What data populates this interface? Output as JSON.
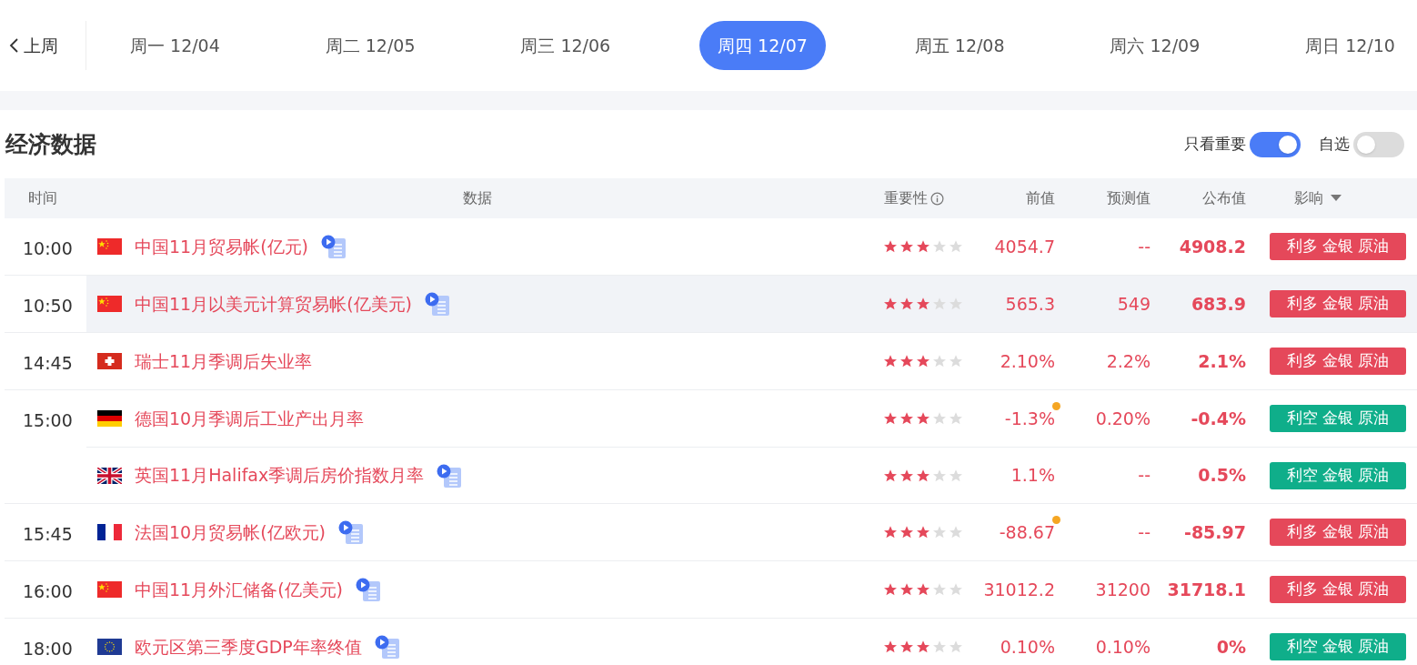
{
  "week_nav": {
    "prev_label": "上周",
    "days": [
      {
        "label": "周一 12/04",
        "selected": false
      },
      {
        "label": "周二 12/05",
        "selected": false
      },
      {
        "label": "周三 12/06",
        "selected": false
      },
      {
        "label": "周四 12/07",
        "selected": true
      },
      {
        "label": "周五 12/08",
        "selected": false
      },
      {
        "label": "周六 12/09",
        "selected": false
      },
      {
        "label": "周日 12/10",
        "selected": false
      }
    ]
  },
  "section": {
    "title": "经济数据",
    "toggles": [
      {
        "label": "只看重要",
        "on": true
      },
      {
        "label": "自选",
        "on": false
      }
    ]
  },
  "table": {
    "columns": [
      "时间",
      "数据",
      "重要性",
      "前值",
      "预测值",
      "公布值",
      "影响"
    ],
    "groups": [
      {
        "time": "10:00",
        "items": [
          {
            "flag": {
              "kind": "cn"
            },
            "name": "中国11月贸易帐(亿元)",
            "has_video": true,
            "highlighted": false,
            "stars": 3,
            "previous": "4054.7",
            "revised": false,
            "forecast": "--",
            "actual": "4908.2",
            "impact": "利多 金银 原油",
            "color": "#e5485a"
          }
        ]
      },
      {
        "time": "10:50",
        "items": [
          {
            "flag": {
              "kind": "cn"
            },
            "name": "中国11月以美元计算贸易帐(亿美元)",
            "has_video": true,
            "highlighted": true,
            "stars": 3,
            "previous": "565.3",
            "revised": false,
            "forecast": "549",
            "actual": "683.9",
            "impact": "利多 金银 原油",
            "color": "#e5485a"
          }
        ]
      },
      {
        "time": "14:45",
        "items": [
          {
            "flag": {
              "kind": "ch"
            },
            "name": "瑞士11月季调后失业率",
            "has_video": false,
            "highlighted": false,
            "stars": 3,
            "previous": "2.10%",
            "revised": false,
            "forecast": "2.2%",
            "actual": "2.1%",
            "impact": "利多 金银 原油",
            "color": "#e5485a"
          }
        ]
      },
      {
        "time": "15:00",
        "items": [
          {
            "flag": {
              "kind": "de"
            },
            "name": "德国10月季调后工业产出月率",
            "has_video": false,
            "highlighted": false,
            "stars": 3,
            "previous": "-1.3%",
            "revised": true,
            "forecast": "0.20%",
            "actual": "-0.4%",
            "impact": "利空 金银 原油",
            "color": "#0fae8a"
          },
          {
            "flag": {
              "kind": "gb"
            },
            "name": "英国11月Halifax季调后房价指数月率",
            "has_video": true,
            "highlighted": false,
            "stars": 3,
            "previous": "1.1%",
            "revised": false,
            "forecast": "--",
            "actual": "0.5%",
            "impact": "利空 金银 原油",
            "color": "#0fae8a"
          }
        ]
      },
      {
        "time": "15:45",
        "items": [
          {
            "flag": {
              "kind": "fr"
            },
            "name": "法国10月贸易帐(亿欧元)",
            "has_video": true,
            "highlighted": false,
            "stars": 3,
            "previous": "-88.67",
            "revised": true,
            "forecast": "--",
            "actual": "-85.97",
            "impact": "利多 金银 原油",
            "color": "#e5485a"
          }
        ]
      },
      {
        "time": "16:00",
        "items": [
          {
            "flag": {
              "kind": "cn"
            },
            "name": "中国11月外汇储备(亿美元)",
            "has_video": true,
            "highlighted": false,
            "stars": 3,
            "previous": "31012.2",
            "revised": false,
            "forecast": "31200",
            "actual": "31718.1",
            "impact": "利多 金银 原油",
            "color": "#e5485a"
          }
        ]
      },
      {
        "time": "18:00",
        "items": [
          {
            "flag": {
              "kind": "eu"
            },
            "name": "欧元区第三季度GDP年率终值",
            "has_video": true,
            "highlighted": false,
            "stars": 3,
            "previous": "0.10%",
            "revised": false,
            "forecast": "0.10%",
            "actual": "0%",
            "impact": "利空 金银 原油",
            "color": "#0fae8a"
          }
        ]
      }
    ]
  }
}
